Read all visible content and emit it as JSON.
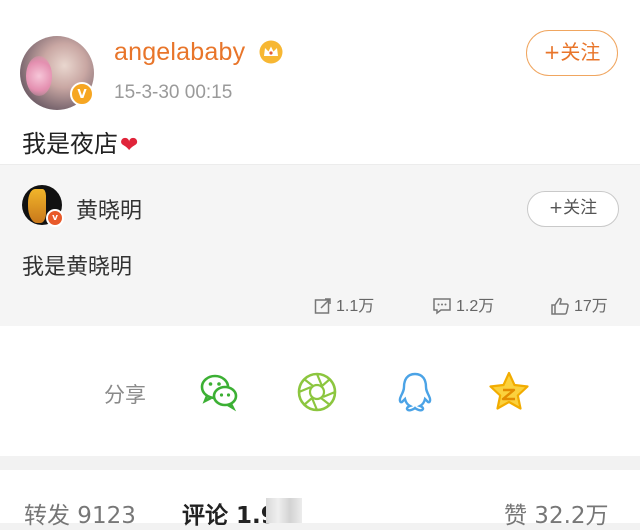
{
  "post": {
    "username": "angelababy",
    "timestamp": "15-3-30 00:15",
    "follow_label": "+关注",
    "text": "我是夜店",
    "heart": "❤",
    "verified_mark": "V"
  },
  "repost": {
    "username": "黄晓明",
    "follow_label": "+关注",
    "text": "我是黄晓明",
    "verified_mark": "v",
    "stats": {
      "reposts": "1.1万",
      "comments": "1.2万",
      "likes": "17万"
    }
  },
  "share": {
    "label": "分享",
    "icons": [
      "wechat-icon",
      "moments-icon",
      "qq-icon",
      "qzone-icon"
    ],
    "colors": {
      "wechat": "#3cb034",
      "moments": "#8cc63f",
      "qq": "#4ba3e6",
      "qzone": "#f5b800"
    }
  },
  "tabs": {
    "repost": "转发 9123",
    "comment": "评论 1.9",
    "like": "赞 32.2万"
  },
  "colors": {
    "accent": "#e8752a",
    "heart": "#e0243a"
  }
}
